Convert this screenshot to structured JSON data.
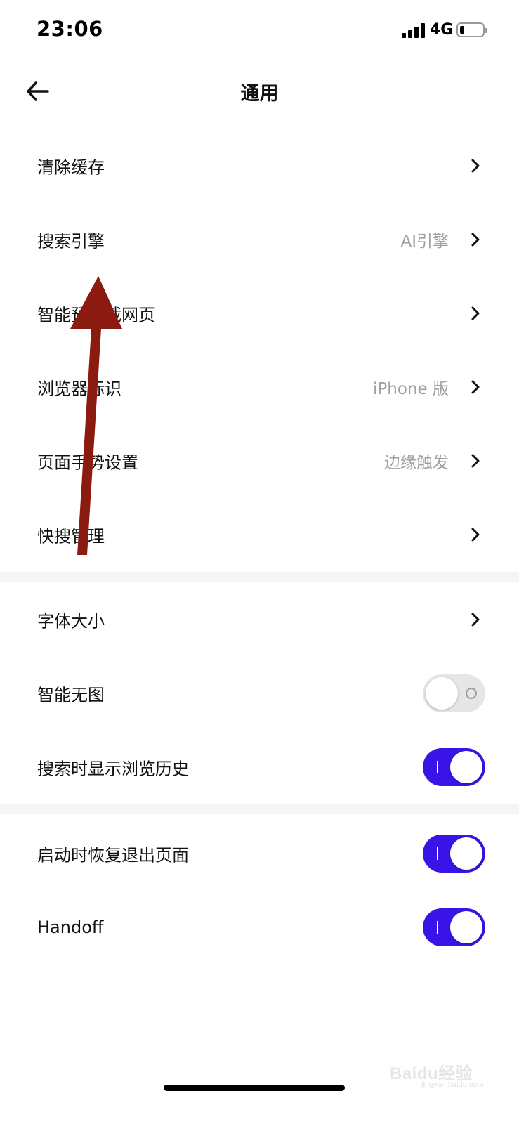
{
  "status_bar": {
    "time": "23:06",
    "network": "4G"
  },
  "nav": {
    "back_icon": "arrow-left-icon",
    "title": "通用"
  },
  "groups": [
    {
      "items": [
        {
          "label": "清除缓存",
          "value": "",
          "type": "link"
        },
        {
          "label": "搜索引擎",
          "value": "AI引擎",
          "type": "link"
        },
        {
          "label": "智能预加载网页",
          "value": "",
          "type": "link"
        },
        {
          "label": "浏览器标识",
          "value": "iPhone 版",
          "type": "link"
        },
        {
          "label": "页面手势设置",
          "value": "边缘触发",
          "type": "link"
        },
        {
          "label": "快搜管理",
          "value": "",
          "type": "link"
        }
      ]
    },
    {
      "items": [
        {
          "label": "字体大小",
          "value": "",
          "type": "link"
        },
        {
          "label": "智能无图",
          "type": "toggle",
          "on": false
        },
        {
          "label": "搜索时显示浏览历史",
          "type": "toggle",
          "on": true
        }
      ]
    },
    {
      "items": [
        {
          "label": "启动时恢复退出页面",
          "type": "toggle",
          "on": true
        },
        {
          "label": "Handoff",
          "type": "toggle",
          "on": true
        }
      ]
    }
  ],
  "colors": {
    "toggle_on": "#3a14e6",
    "toggle_off": "#e6e6e6",
    "annotation_arrow": "#8b1a10"
  },
  "watermark": {
    "main": "Baidu经验",
    "sub": "jingyan.baidu.com"
  }
}
